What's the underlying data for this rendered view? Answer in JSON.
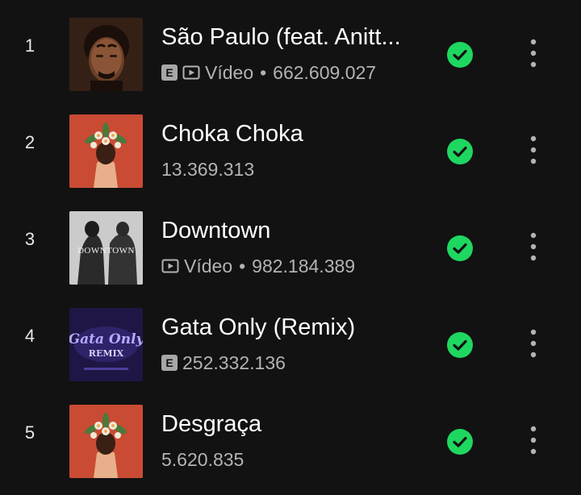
{
  "tracks": [
    {
      "rank": "1",
      "title": "São Paulo (feat. Anitt...",
      "explicit": true,
      "explicit_label": "E",
      "has_video": true,
      "video_label": "Vídeo",
      "separator": "•",
      "plays": "662.609.027",
      "saved": true,
      "art_icon": "portrait-man-art"
    },
    {
      "rank": "2",
      "title": "Choka Choka",
      "explicit": false,
      "has_video": false,
      "plays": "13.369.313",
      "saved": true,
      "art_icon": "red-floral-cover-art"
    },
    {
      "rank": "3",
      "title": "Downtown",
      "explicit": false,
      "has_video": true,
      "video_label": "Vídeo",
      "separator": "•",
      "plays": "982.184.389",
      "saved": true,
      "art_icon": "downtown-bw-cover-art",
      "art_text": "DOWNTOWN"
    },
    {
      "rank": "4",
      "title": "Gata Only (Remix)",
      "explicit": true,
      "explicit_label": "E",
      "has_video": false,
      "plays": "252.332.136",
      "saved": true,
      "art_icon": "gata-only-purple-cover-art",
      "art_text_line1": "Gata Only",
      "art_text_line2": "REMIX"
    },
    {
      "rank": "5",
      "title": "Desgraça",
      "explicit": false,
      "has_video": false,
      "plays": "5.620.835",
      "saved": true,
      "art_icon": "red-floral-cover-art"
    }
  ],
  "colors": {
    "background": "#121212",
    "accent_green": "#1ed760",
    "secondary_text": "#b3b3b3"
  }
}
